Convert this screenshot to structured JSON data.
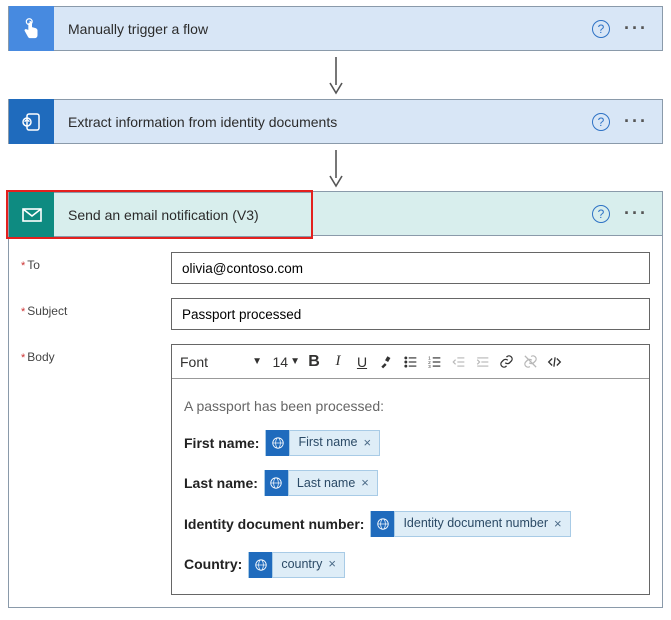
{
  "steps": {
    "s0": {
      "title": "Manually trigger a flow"
    },
    "s1": {
      "title": "Extract information from identity documents"
    },
    "s2": {
      "title": "Send an email notification (V3)"
    }
  },
  "form": {
    "to_label": "To",
    "to_value": "olivia@contoso.com",
    "subject_label": "Subject",
    "subject_value": "Passport processed",
    "body_label": "Body",
    "toolbar": {
      "font": "Font",
      "size": "14"
    },
    "intro": "A passport has been processed:",
    "fields": {
      "first": {
        "label": "First name:",
        "token": "First name"
      },
      "last": {
        "label": "Last name:",
        "token": "Last name"
      },
      "docnum": {
        "label": "Identity document number:",
        "token": "Identity document number"
      },
      "country": {
        "label": "Country:",
        "token": "country"
      }
    }
  }
}
